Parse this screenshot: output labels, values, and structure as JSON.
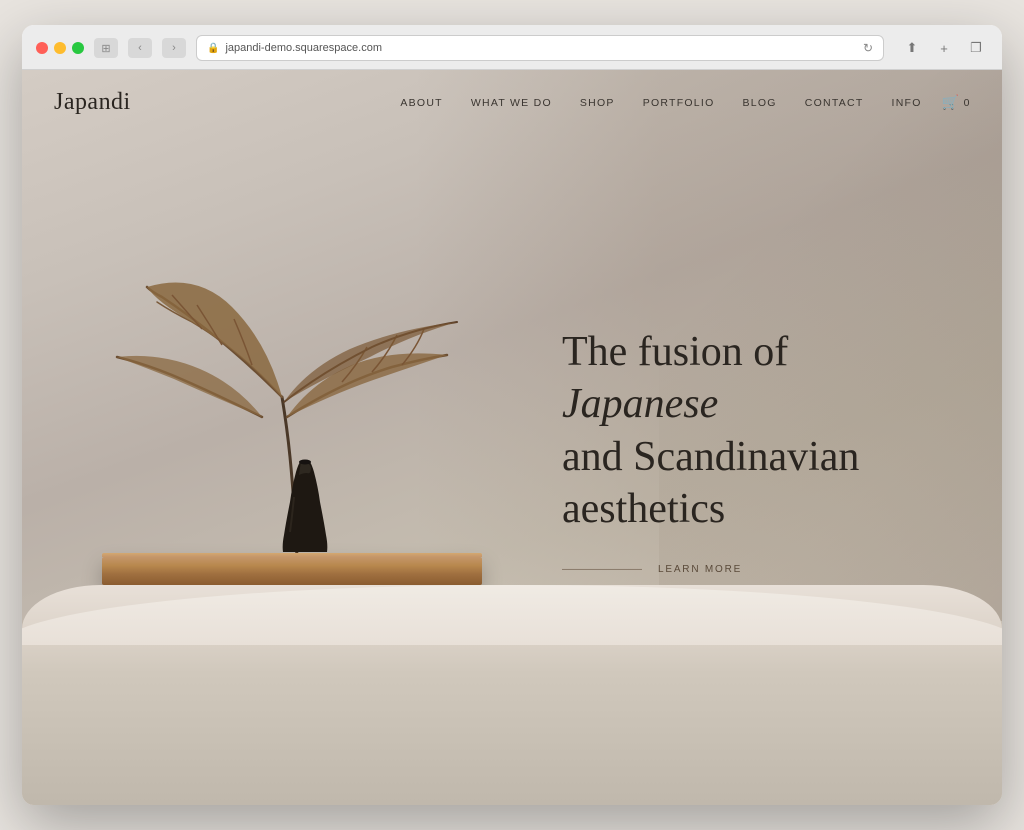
{
  "browser": {
    "url": "japandi-demo.squarespace.com",
    "traffic_lights": [
      "red",
      "yellow",
      "green"
    ],
    "back_btn": "‹",
    "forward_btn": "›",
    "window_btn": "⊡",
    "share_btn": "⬆",
    "new_tab_btn": "+",
    "copy_btn": "❐",
    "refresh_btn": "↻"
  },
  "nav": {
    "logo": "Japandi",
    "links": [
      {
        "label": "ABOUT",
        "id": "about"
      },
      {
        "label": "WHAT WE DO",
        "id": "what-we-do"
      },
      {
        "label": "SHOP",
        "id": "shop"
      },
      {
        "label": "PORTFOLIO",
        "id": "portfolio"
      },
      {
        "label": "BLOG",
        "id": "blog"
      },
      {
        "label": "CONTACT",
        "id": "contact"
      },
      {
        "label": "INFO",
        "id": "info"
      }
    ],
    "cart_count": "0"
  },
  "hero": {
    "heading_plain": "The fusion of ",
    "heading_italic": "Japanese",
    "heading_plain2": " and Scandinavian aesthetics",
    "learn_more": "LEARN MORE"
  }
}
